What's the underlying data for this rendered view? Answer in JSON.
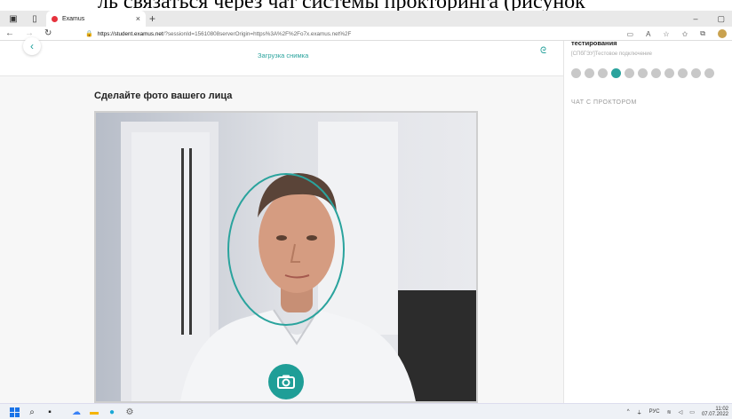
{
  "document_strip": "ль связаться через чат системы прокторинга (рисунок",
  "browser": {
    "tab_title": "Examus",
    "tab_close": "×",
    "new_tab": "+",
    "url_host": "https://student.examus.net",
    "url_rest": "/?sessionId=15610808serverOrigin=https%3A%2F%2Fo7x.examus.net%2F",
    "win_min": "–",
    "win_max": "▢"
  },
  "page": {
    "step_label": "Загрузка снимка",
    "heading": "Сделайте фото вашего лица",
    "accent": "#2aa39d"
  },
  "sidebar": {
    "title": "тестирования",
    "subtitle": "[СПбГЭУ]Тестовое подключение",
    "step_count": 11,
    "active_index": 3,
    "chat_header": "ЧАТ С ПРОКТОРОМ"
  },
  "taskbar": {
    "lang": "РУС",
    "time": "11:02",
    "date": "07.07.2022"
  }
}
